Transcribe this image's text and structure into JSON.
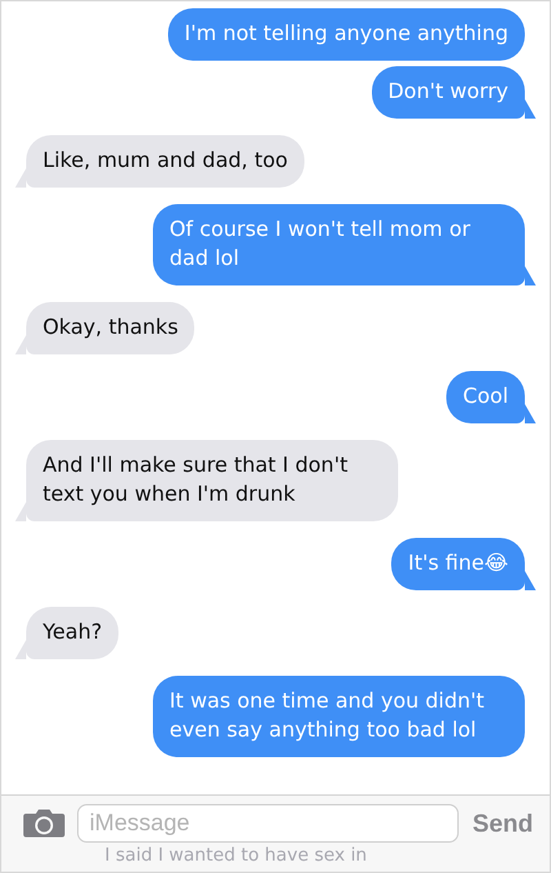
{
  "messages": [
    {
      "kind": "sent",
      "text": "I'm not telling anyone anything",
      "tail": false
    },
    {
      "kind": "sent",
      "text": "Don't worry",
      "tail": true
    },
    {
      "kind": "received",
      "text": "Like, mum and dad, too",
      "tail": true
    },
    {
      "kind": "sent",
      "text": "Of course I won't tell mom or dad lol",
      "tail": true
    },
    {
      "kind": "received",
      "text": "Okay, thanks",
      "tail": true
    },
    {
      "kind": "sent",
      "text": "Cool",
      "tail": true
    },
    {
      "kind": "received",
      "text": "And I'll make sure that I don't text you when I'm drunk",
      "tail": true
    },
    {
      "kind": "sent",
      "text": "It's fine😂",
      "tail": true
    },
    {
      "kind": "received",
      "text": "Yeah?",
      "tail": true
    },
    {
      "kind": "sent",
      "text": "It was one time and you didn't even say anything too bad lol",
      "tail": false
    }
  ],
  "composer": {
    "placeholder": "iMessage",
    "send": "Send",
    "text_behind": "I said I wanted to have sex in"
  }
}
